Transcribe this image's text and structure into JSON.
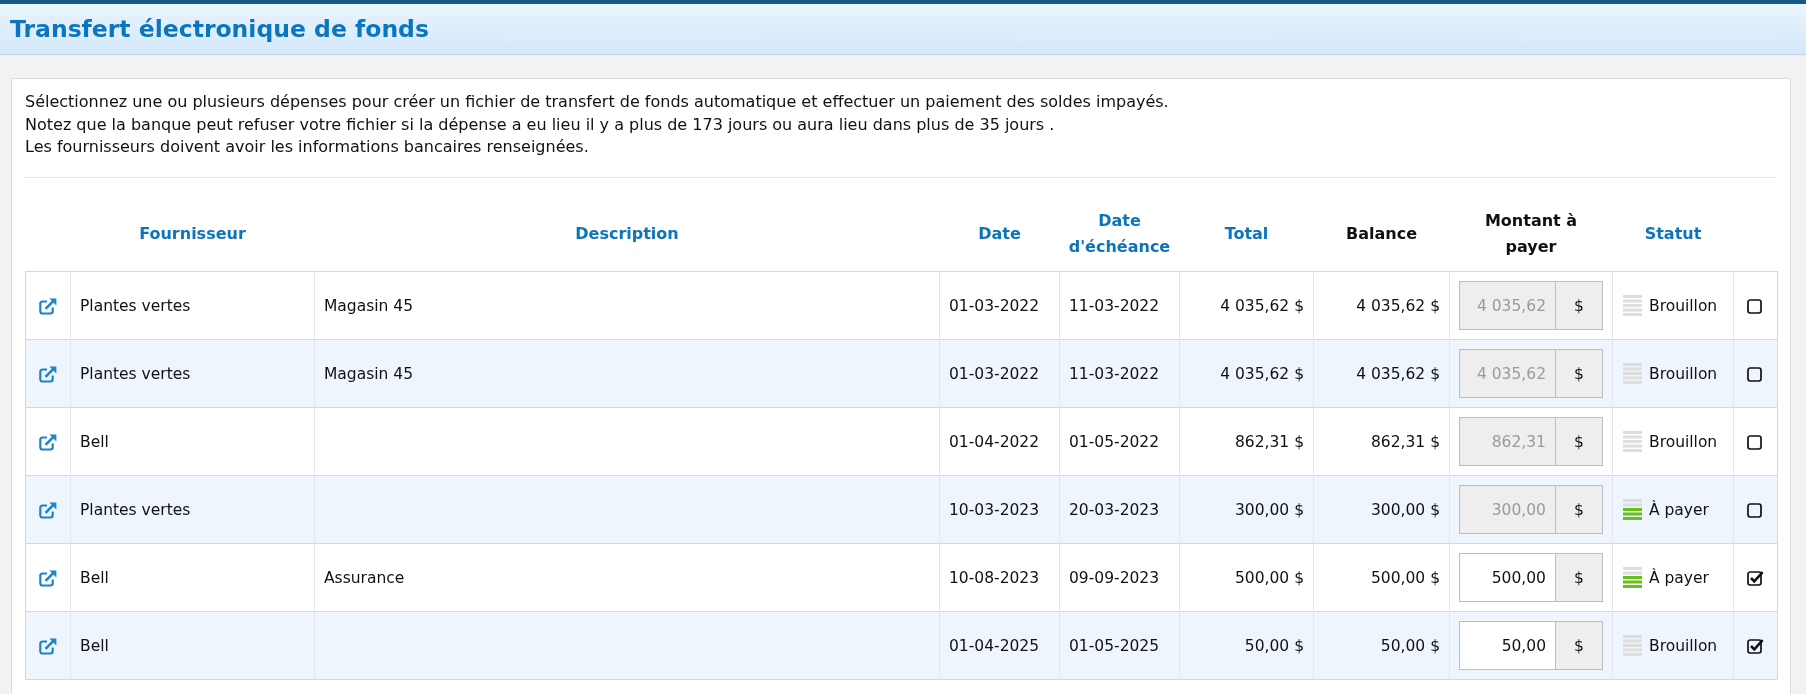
{
  "page": {
    "title": "Transfert électronique de fonds"
  },
  "intro": [
    "Sélectionnez une ou plusieurs dépenses pour créer un fichier de transfert de fonds automatique et effectuer un paiement des soldes impayés.",
    "Notez que la banque peut refuser votre fichier si la dépense a eu lieu il y a plus de 173 jours ou aura lieu dans plus de 35 jours .",
    "Les fournisseurs doivent avoir les informations bancaires renseignées."
  ],
  "table": {
    "columns": [
      {
        "label": "Fournisseur",
        "sortable": true
      },
      {
        "label": "Description",
        "sortable": true
      },
      {
        "label": "Date",
        "sortable": true
      },
      {
        "label": "Date d'échéance",
        "sortable": true
      },
      {
        "label": "Total",
        "sortable": true
      },
      {
        "label": "Balance",
        "sortable": false
      },
      {
        "label": "Montant à payer",
        "sortable": false
      },
      {
        "label": "Statut",
        "sortable": true
      }
    ],
    "rows": [
      {
        "supplier": "Plantes vertes",
        "description": "Magasin 45",
        "date": "01-03-2022",
        "due_date": "11-03-2022",
        "total": "4 035,62 $",
        "balance": "4 035,62 $",
        "amount": {
          "value": "4 035,62",
          "disabled": true
        },
        "currency": "$",
        "status": {
          "label": "Brouillon",
          "kind": "draft"
        },
        "checked": false
      },
      {
        "supplier": "Plantes vertes",
        "description": "Magasin 45",
        "date": "01-03-2022",
        "due_date": "11-03-2022",
        "total": "4 035,62 $",
        "balance": "4 035,62 $",
        "amount": {
          "value": "4 035,62",
          "disabled": true
        },
        "currency": "$",
        "status": {
          "label": "Brouillon",
          "kind": "draft"
        },
        "checked": false
      },
      {
        "supplier": "Bell",
        "date": "01-04-2022",
        "due_date": "01-05-2022",
        "total": "862,31 $",
        "balance": "862,31 $",
        "amount": {
          "value": "862,31",
          "disabled": true
        },
        "currency": "$",
        "status": {
          "label": "Brouillon",
          "kind": "draft"
        },
        "checked": false
      },
      {
        "supplier": "Plantes vertes",
        "date": "10-03-2023",
        "due_date": "20-03-2023",
        "total": "300,00 $",
        "balance": "300,00 $",
        "amount": {
          "value": "300,00",
          "disabled": true
        },
        "currency": "$",
        "status": {
          "label": "À payer",
          "kind": "to_pay"
        },
        "checked": false
      },
      {
        "supplier": "Bell",
        "description": "Assurance",
        "date": "10-08-2023",
        "due_date": "09-09-2023",
        "total": "500,00 $",
        "balance": "500,00 $",
        "amount": {
          "value": "500,00",
          "disabled": false
        },
        "currency": "$",
        "status": {
          "label": "À payer",
          "kind": "to_pay"
        },
        "checked": true
      },
      {
        "supplier": "Bell",
        "date": "01-04-2025",
        "due_date": "01-05-2025",
        "total": "50,00 $",
        "balance": "50,00 $",
        "amount": {
          "value": "50,00",
          "disabled": false
        },
        "currency": "$",
        "status": {
          "label": "Brouillon",
          "kind": "draft"
        },
        "checked": true
      }
    ]
  }
}
